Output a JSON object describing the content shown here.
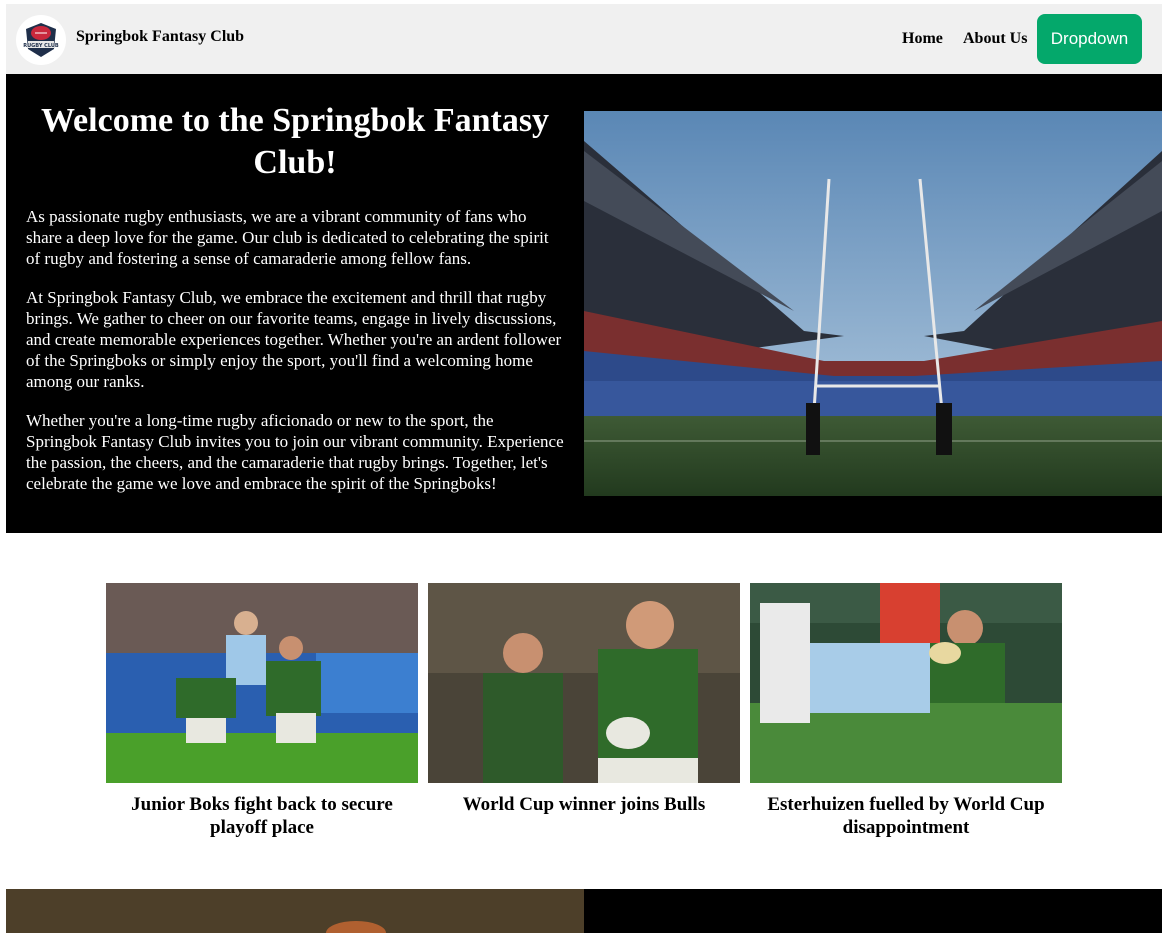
{
  "nav": {
    "brand": "Springbok Fantasy Club",
    "logo_text": "RUGBY CLUB",
    "links": [
      "Home",
      "About Us"
    ],
    "dropdown_label": "Dropdown"
  },
  "hero": {
    "title": "Welcome to the Springbok Fantasy Club!",
    "paragraphs": [
      "As passionate rugby enthusiasts, we are a vibrant community of fans who share a deep love for the game. Our club is dedicated to celebrating the spirit of rugby and fostering a sense of camaraderie among fellow fans.",
      "At Springbok Fantasy Club, we embrace the excitement and thrill that rugby brings. We gather to cheer on our favorite teams, engage in lively discussions, and create memorable experiences together. Whether you're an ardent follower of the Springboks or simply enjoy the sport, you'll find a welcoming home among our ranks.",
      "Whether you're a long-time rugby aficionado or new to the sport, the Springbok Fantasy Club invites you to join our vibrant community. Experience the passion, the cheers, and the camaraderie that rugby brings. Together, let's celebrate the game we love and embrace the spirit of the Springboks!"
    ]
  },
  "news": [
    {
      "title": "Junior Boks fight back to secure playoff place"
    },
    {
      "title": "World Cup winner joins Bulls"
    },
    {
      "title": "Esterhuizen fuelled by World Cup disappointment"
    }
  ],
  "colors": {
    "accent": "#04a86b",
    "nav_bg": "#f0f0f0",
    "hero_bg": "#000000"
  }
}
